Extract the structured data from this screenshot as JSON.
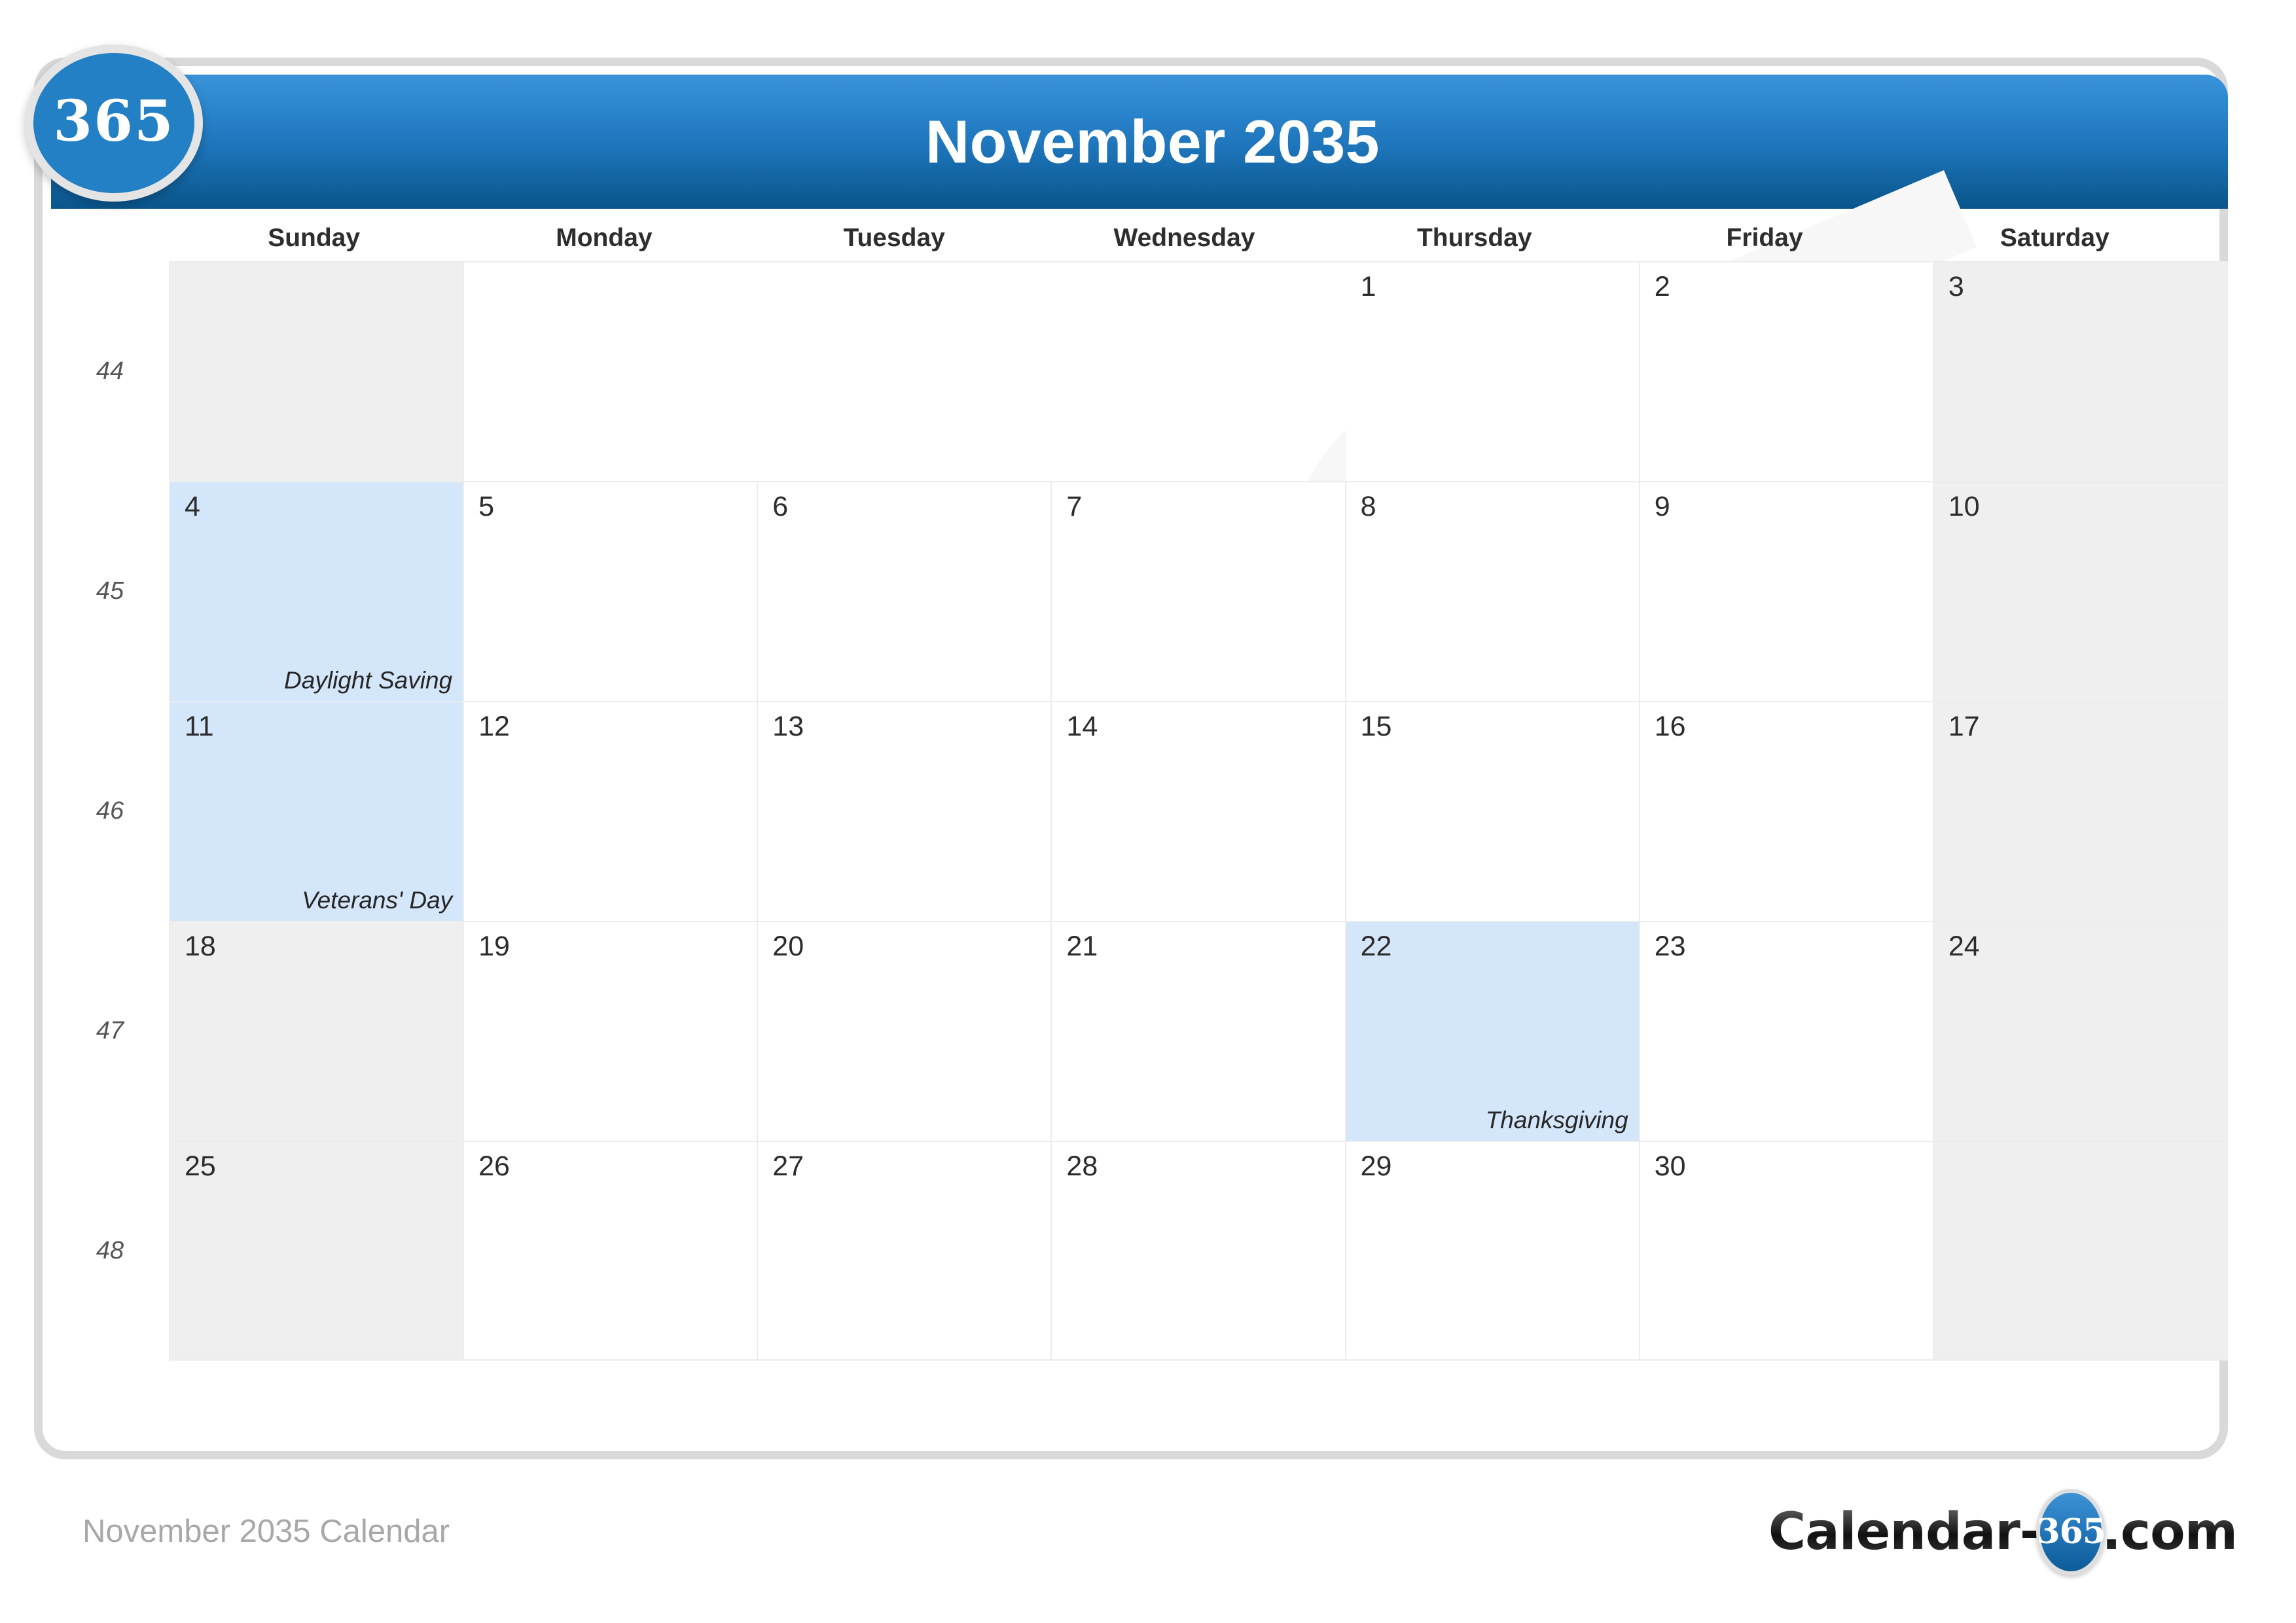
{
  "header": {
    "title": "November 2035",
    "logo_badge": "365"
  },
  "weekdays": [
    "Sunday",
    "Monday",
    "Tuesday",
    "Wednesday",
    "Thursday",
    "Friday",
    "Saturday"
  ],
  "watermark": "365",
  "weeks": [
    {
      "week_number": "44",
      "days": [
        {
          "number": "",
          "holiday": "",
          "weekend": true,
          "blank": true
        },
        {
          "number": "",
          "holiday": "",
          "weekend": false,
          "blank": true
        },
        {
          "number": "",
          "holiday": "",
          "weekend": false,
          "blank": true
        },
        {
          "number": "",
          "holiday": "",
          "weekend": false,
          "blank": true
        },
        {
          "number": "1",
          "holiday": "",
          "weekend": false,
          "blank": false
        },
        {
          "number": "2",
          "holiday": "",
          "weekend": false,
          "blank": false
        },
        {
          "number": "3",
          "holiday": "",
          "weekend": true,
          "blank": false
        }
      ]
    },
    {
      "week_number": "45",
      "days": [
        {
          "number": "4",
          "holiday": "Daylight Saving",
          "weekend": true,
          "blank": false
        },
        {
          "number": "5",
          "holiday": "",
          "weekend": false,
          "blank": false
        },
        {
          "number": "6",
          "holiday": "",
          "weekend": false,
          "blank": false
        },
        {
          "number": "7",
          "holiday": "",
          "weekend": false,
          "blank": false
        },
        {
          "number": "8",
          "holiday": "",
          "weekend": false,
          "blank": false
        },
        {
          "number": "9",
          "holiday": "",
          "weekend": false,
          "blank": false
        },
        {
          "number": "10",
          "holiday": "",
          "weekend": true,
          "blank": false
        }
      ]
    },
    {
      "week_number": "46",
      "days": [
        {
          "number": "11",
          "holiday": "Veterans' Day",
          "weekend": true,
          "blank": false
        },
        {
          "number": "12",
          "holiday": "",
          "weekend": false,
          "blank": false
        },
        {
          "number": "13",
          "holiday": "",
          "weekend": false,
          "blank": false
        },
        {
          "number": "14",
          "holiday": "",
          "weekend": false,
          "blank": false
        },
        {
          "number": "15",
          "holiday": "",
          "weekend": false,
          "blank": false
        },
        {
          "number": "16",
          "holiday": "",
          "weekend": false,
          "blank": false
        },
        {
          "number": "17",
          "holiday": "",
          "weekend": true,
          "blank": false
        }
      ]
    },
    {
      "week_number": "47",
      "days": [
        {
          "number": "18",
          "holiday": "",
          "weekend": true,
          "blank": false
        },
        {
          "number": "19",
          "holiday": "",
          "weekend": false,
          "blank": false
        },
        {
          "number": "20",
          "holiday": "",
          "weekend": false,
          "blank": false
        },
        {
          "number": "21",
          "holiday": "",
          "weekend": false,
          "blank": false
        },
        {
          "number": "22",
          "holiday": "Thanksgiving",
          "weekend": false,
          "blank": false
        },
        {
          "number": "23",
          "holiday": "",
          "weekend": false,
          "blank": false
        },
        {
          "number": "24",
          "holiday": "",
          "weekend": true,
          "blank": false
        }
      ]
    },
    {
      "week_number": "48",
      "days": [
        {
          "number": "25",
          "holiday": "",
          "weekend": true,
          "blank": false
        },
        {
          "number": "26",
          "holiday": "",
          "weekend": false,
          "blank": false
        },
        {
          "number": "27",
          "holiday": "",
          "weekend": false,
          "blank": false
        },
        {
          "number": "28",
          "holiday": "",
          "weekend": false,
          "blank": false
        },
        {
          "number": "29",
          "holiday": "",
          "weekend": false,
          "blank": false
        },
        {
          "number": "30",
          "holiday": "",
          "weekend": false,
          "blank": false
        },
        {
          "number": "",
          "holiday": "",
          "weekend": true,
          "blank": true
        }
      ]
    }
  ],
  "footer": {
    "caption": "November 2035 Calendar",
    "logo_pre": "Calendar-",
    "logo_badge": "365",
    "logo_post": ".com"
  },
  "colors": {
    "header_top": "#3a93d8",
    "header_bottom": "#0a558c",
    "holiday_bg": "#d4e7fa",
    "weekend_bg": "#efefef",
    "card_border": "#d9d9d9",
    "grid_line": "#ececec"
  }
}
